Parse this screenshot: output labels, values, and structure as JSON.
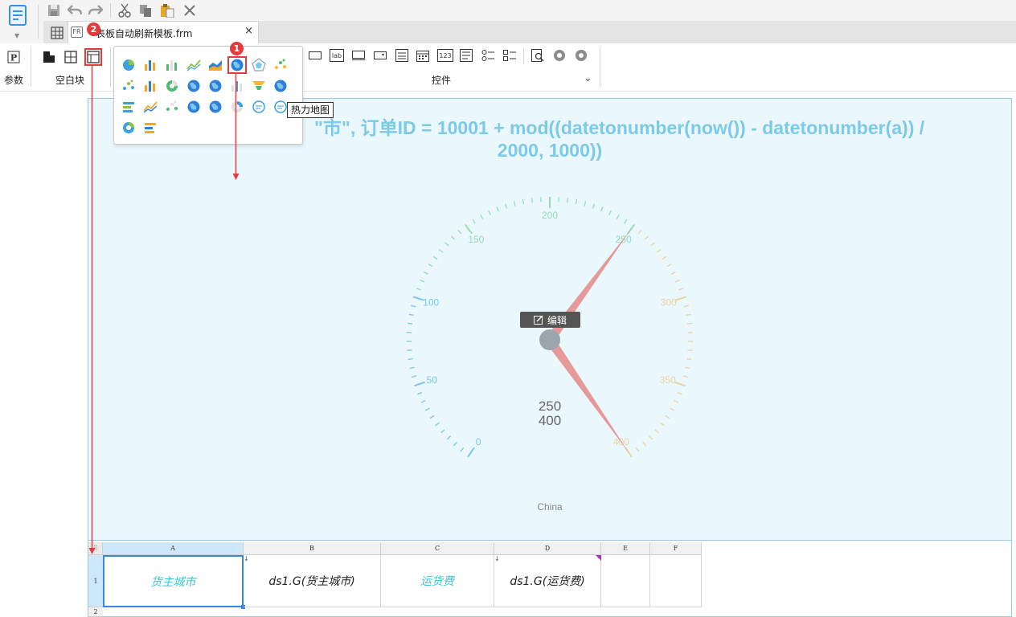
{
  "quick_access": {
    "buttons": [
      "save",
      "undo",
      "redo",
      "cut",
      "copy",
      "paste",
      "delete"
    ]
  },
  "tabs": {
    "file_name": "表板自动刷新模板.frm",
    "file_icon_text": "FR",
    "close": "×"
  },
  "annotations": {
    "badge_1": "1",
    "badge_2": "2"
  },
  "ribbon": {
    "param_icon": "P",
    "param_label": "参数",
    "blank_label": "空白块",
    "control_label": "控件",
    "control_icons": [
      "lab",
      "123"
    ],
    "chevron": "⌄"
  },
  "chart_popup": {
    "icons": [
      "pie-chart-icon",
      "bar-chart-icon",
      "horizontal-bar-icon",
      "line-chart-icon",
      "area-chart-icon",
      "heatmap-icon",
      "radar-chart-icon",
      "scatter-chart-icon",
      "bubble-chart-icon",
      "combo-chart-icon",
      "donut-chart-icon",
      "map-icon",
      "map-alt-icon",
      "stacked-bar-icon",
      "funnel-icon",
      "globe-map-icon",
      "gantt-icon",
      "range-area-icon",
      "tree-icon",
      "world-map-icon",
      "world-map-alt-icon",
      "progress-ring-icon",
      "word-cloud-icon",
      "frame-icon",
      "gauge-ring-icon",
      "layered-icon"
    ],
    "tooltip": "热力地图"
  },
  "canvas": {
    "formula_line1": "=                         \"市\", 订单ID = 10001 + mod((datetonumber(now()) - datetonumber(a)) /",
    "formula_line2": "2000, 1000))",
    "edit_label": "编辑",
    "gauge": {
      "ticks": [
        "0",
        "50",
        "100",
        "150",
        "200",
        "250",
        "300",
        "350",
        "400"
      ],
      "value_1": "250",
      "value_2": "400",
      "caption": "China",
      "range_min": 0,
      "range_max": 400,
      "needle_values": [
        250,
        400
      ],
      "colors": {
        "needle": "#e48a87",
        "hub": "#9aa5ad",
        "low": "#7cc6e8",
        "mid": "#93dcb7",
        "high": "#e7d49c"
      }
    }
  },
  "sheet": {
    "columns": [
      "A",
      "B",
      "C",
      "D",
      "E",
      "F"
    ],
    "rows": [
      "1",
      "2"
    ],
    "cells": [
      "货主城市",
      "ds1.G(货主城市)",
      "运货费",
      "ds1.G(运货费)"
    ]
  }
}
